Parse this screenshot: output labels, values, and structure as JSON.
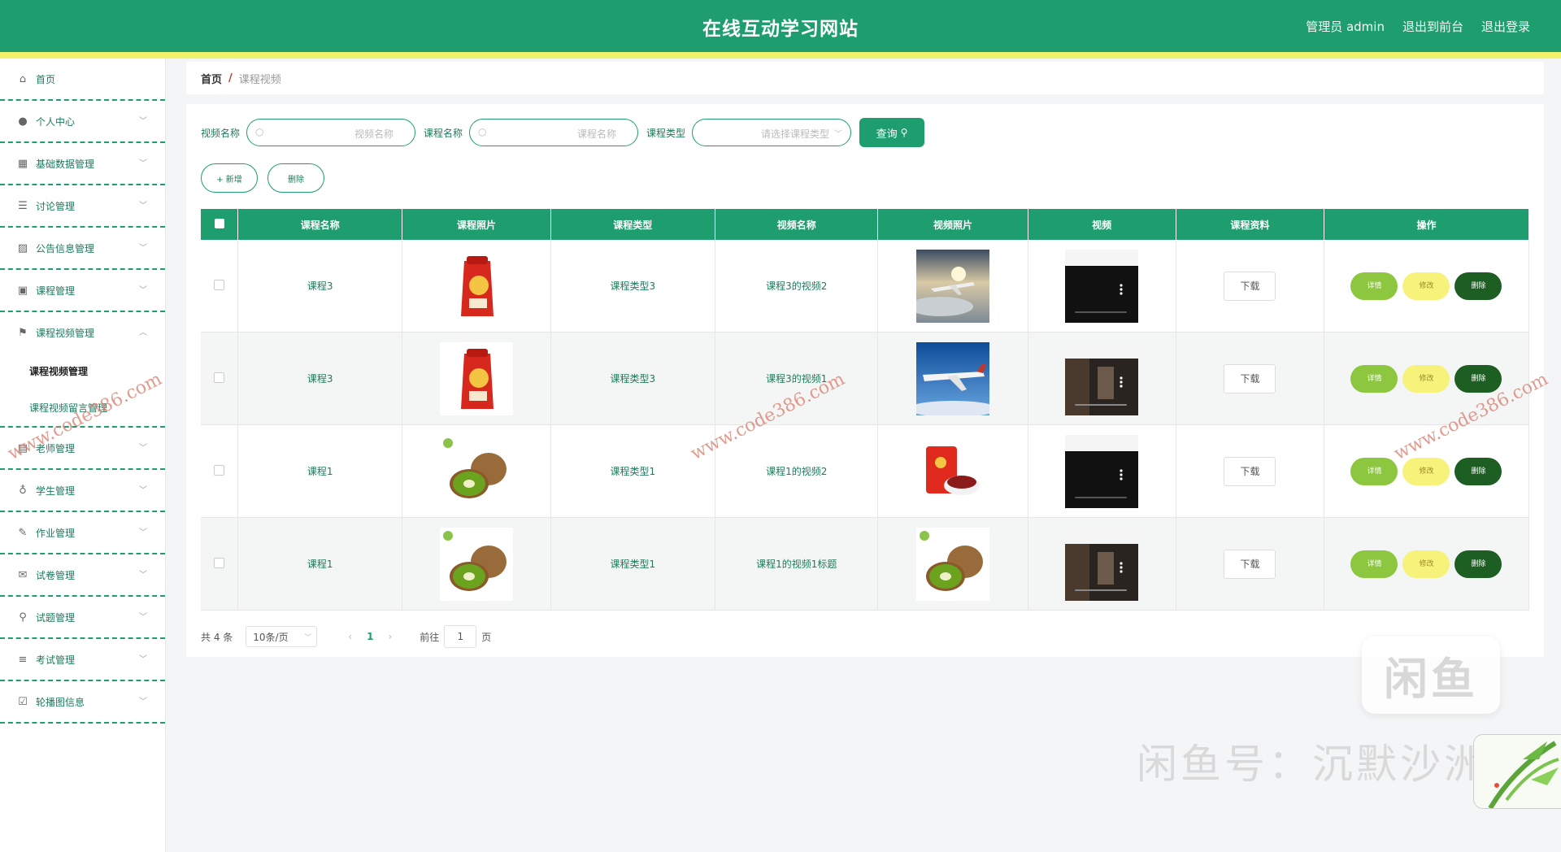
{
  "header": {
    "title": "在线互动学习网站",
    "links": [
      "管理员 admin",
      "退出到前台",
      "退出登录"
    ]
  },
  "sidebar": {
    "items": [
      {
        "label": "首页",
        "icon": "home-icon"
      },
      {
        "label": "个人中心",
        "icon": "user-icon"
      },
      {
        "label": "基础数据管理",
        "icon": "grid-icon"
      },
      {
        "label": "讨论管理",
        "icon": "list-icon"
      },
      {
        "label": "公告信息管理",
        "icon": "chart-icon"
      },
      {
        "label": "课程管理",
        "icon": "box-icon"
      },
      {
        "label": "课程视频管理",
        "icon": "flag-icon"
      }
    ],
    "submenu": [
      "课程视频管理",
      "课程视频留言管理"
    ],
    "items_after": [
      {
        "label": "老师管理",
        "icon": "folder-icon"
      },
      {
        "label": "学生管理",
        "icon": "mic-icon"
      },
      {
        "label": "作业管理",
        "icon": "edit-icon"
      },
      {
        "label": "试卷管理",
        "icon": "mail-icon"
      },
      {
        "label": "试题管理",
        "icon": "pin-icon"
      },
      {
        "label": "考试管理",
        "icon": "menu-icon"
      },
      {
        "label": "轮播图信息",
        "icon": "check-icon"
      }
    ]
  },
  "breadcrumb": {
    "home": "首页",
    "separator": "/",
    "current": "课程视频"
  },
  "search": {
    "video_label": "视频名称",
    "video_placeholder": "视频名称",
    "course_label": "课程名称",
    "course_placeholder": "课程名称",
    "type_label": "课程类型",
    "type_placeholder": "请选择课程类型",
    "query_button": "查询"
  },
  "actions": {
    "add": "+ 新增",
    "delete": "删除"
  },
  "table": {
    "headers": [
      "课程名称",
      "课程照片",
      "课程类型",
      "视频名称",
      "视频照片",
      "视频",
      "课程资料",
      "操作"
    ],
    "rows": [
      {
        "course": "课程3",
        "course_img": "rice-bag",
        "type": "课程类型3",
        "video_name": "课程3的视频2",
        "video_img": "airplane-clouds",
        "video": "dark-player",
        "download": "下载"
      },
      {
        "course": "课程3",
        "course_img": "rice-bag",
        "type": "课程类型3",
        "video_name": "课程3的视频1",
        "video_img": "airplane-sky",
        "video": "room-player",
        "download": "下载"
      },
      {
        "course": "课程1",
        "course_img": "kiwi",
        "type": "课程类型1",
        "video_name": "课程1的视频2",
        "video_img": "red-bag-dates",
        "video": "dark-player",
        "download": "下载"
      },
      {
        "course": "课程1",
        "course_img": "kiwi",
        "type": "课程类型1",
        "video_name": "课程1的视频1标题",
        "video_img": "kiwi",
        "video": "room-player",
        "download": "下载"
      }
    ],
    "ops": {
      "detail": "详情",
      "edit": "修改",
      "delete": "删除"
    }
  },
  "pagination": {
    "total": "共 4 条",
    "page_size": "10条/页",
    "current_page": "1",
    "goto_label": "前往",
    "goto_value": "1",
    "page_unit": "页"
  },
  "watermarks": {
    "site": "www.code386.com",
    "xianyu_logo": "闲鱼",
    "xianyu_id": "闲鱼号：沉默沙洲"
  },
  "colors": {
    "primary": "#1e9e6e",
    "accent": "#f2f26a",
    "detail": "#8dc63f",
    "edit": "#f6f27a",
    "delete": "#1d5e22"
  }
}
